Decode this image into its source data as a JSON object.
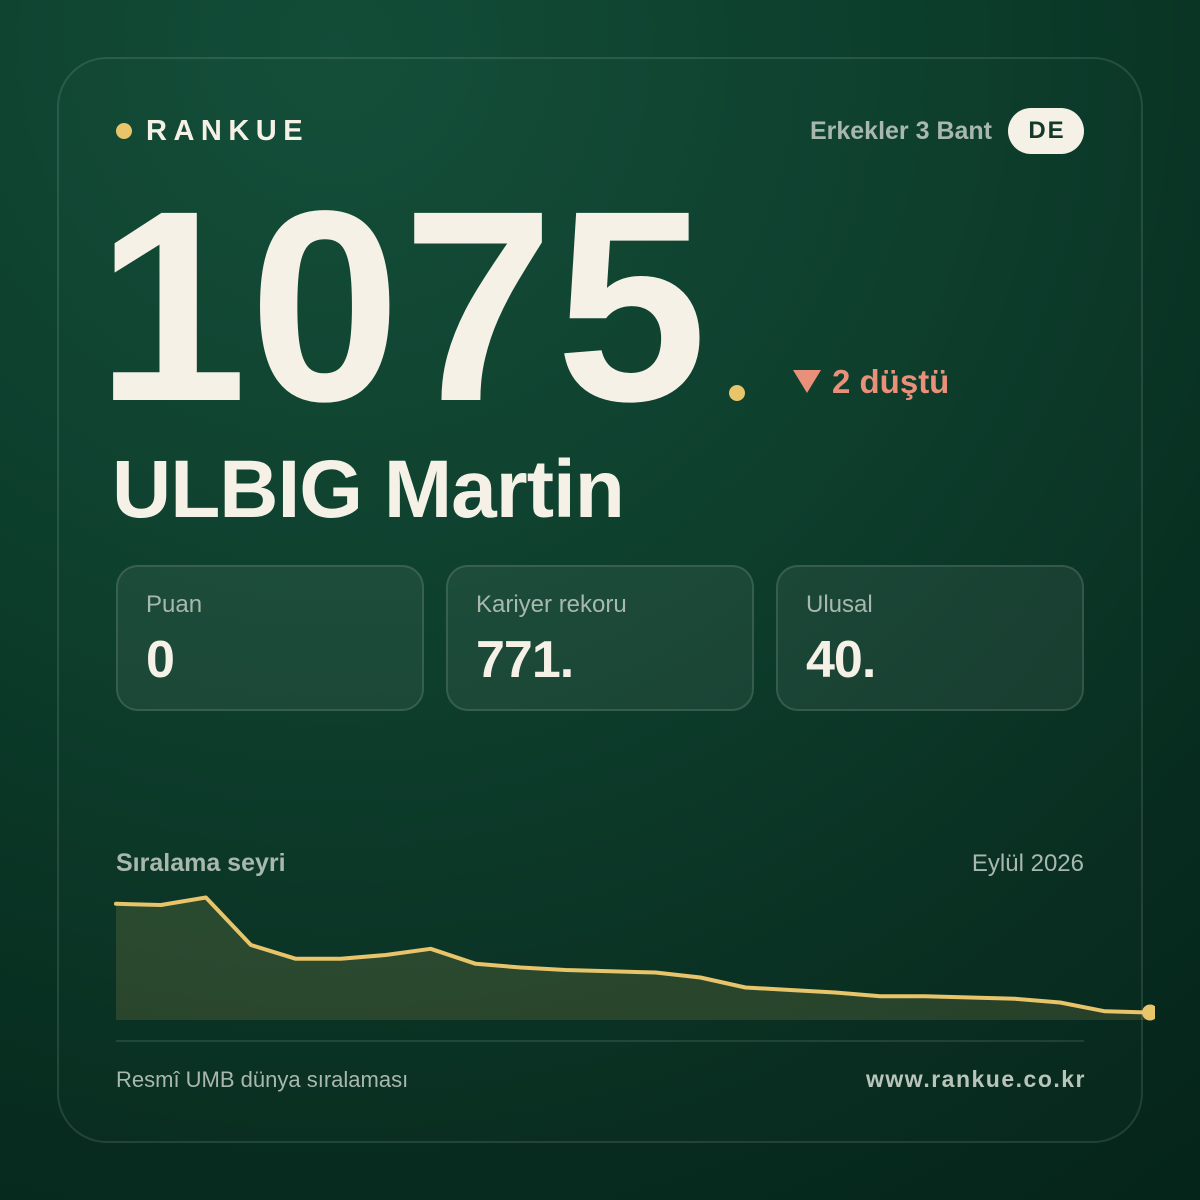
{
  "brand": {
    "name": "RANKUE"
  },
  "category": {
    "label": "Erkekler 3 Bant",
    "country": "DE"
  },
  "rank": {
    "value": "1075",
    "change_icon": "triangle-down-icon",
    "change_label": "2 düştü"
  },
  "player": {
    "name": "ULBIG Martin"
  },
  "stats": [
    {
      "label": "Puan",
      "value": "0"
    },
    {
      "label": "Kariyer rekoru",
      "value": "771."
    },
    {
      "label": "Ulusal",
      "value": "40."
    }
  ],
  "chart_data": {
    "type": "area",
    "title": "Sıralama seyri",
    "annotation": "Eylül 2026",
    "values": [
      93,
      92,
      98,
      60,
      49,
      49,
      52,
      57,
      45,
      42,
      40,
      39,
      38,
      34,
      26,
      24,
      22,
      19,
      19,
      18,
      17,
      14,
      7,
      6
    ],
    "ylim": [
      0,
      100
    ],
    "grid": false,
    "legend": "none",
    "line_color": "#e8c46a",
    "fill_color": "rgba(232,196,106,0.14)"
  },
  "footer": {
    "source": "Resmî UMB dünya sıralaması",
    "website": "www.rankue.co.kr"
  },
  "colors": {
    "background": "#0c3d2b",
    "accent": "#e8c46a",
    "text": "#f5f1e6",
    "muted": "#a9b8ae",
    "decline": "#e8907a",
    "pill_text": "#133a2a"
  }
}
